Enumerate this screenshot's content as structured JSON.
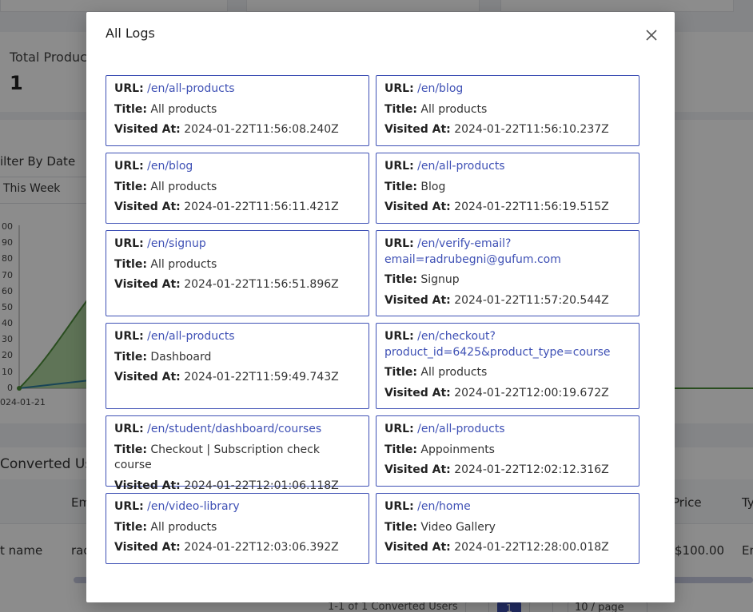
{
  "background": {
    "total_label": "Total Produc",
    "total_value": "1",
    "filter_label": "ilter By Date",
    "filter_value": "This Week",
    "chart_ticks": [
      "00",
      "90",
      "80",
      "70",
      "60",
      "50",
      "40",
      "30",
      "20",
      "10",
      "0"
    ],
    "chart_xlabel": "024-01-21",
    "table_title": "Converted Us",
    "table_headers": {
      "email": "Em",
      "price": "Price",
      "type": "Ty"
    },
    "table_row": {
      "name": "t name",
      "email": "rad",
      "price": "$100.00",
      "type": "En"
    },
    "pager_text": "1-1 of 1 Converted Users",
    "pager_current": "1",
    "page_size": "10 / page"
  },
  "modal": {
    "title": "All Logs",
    "labels": {
      "url": "URL:",
      "title": "Title:",
      "visited": "Visited At:"
    },
    "logs": [
      {
        "url": "/en/all-products",
        "title": "All products",
        "visited_at": "2024-01-22T11:56:08.240Z"
      },
      {
        "url": "/en/blog",
        "title": "All products",
        "visited_at": "2024-01-22T11:56:10.237Z"
      },
      {
        "url": "/en/blog",
        "title": "All products",
        "visited_at": "2024-01-22T11:56:11.421Z"
      },
      {
        "url": "/en/all-products",
        "title": "Blog",
        "visited_at": "2024-01-22T11:56:19.515Z"
      },
      {
        "url": "/en/signup",
        "title": "All products",
        "visited_at": "2024-01-22T11:56:51.896Z"
      },
      {
        "url": "/en/verify-email?email=radrubegni@gufum.com",
        "title": "Signup",
        "visited_at": "2024-01-22T11:57:20.544Z"
      },
      {
        "url": "/en/all-products",
        "title": "Dashboard",
        "visited_at": "2024-01-22T11:59:49.743Z"
      },
      {
        "url": "/en/checkout?product_id=6425&product_type=course",
        "title": "All products",
        "visited_at": "2024-01-22T12:00:19.672Z"
      },
      {
        "url": "/en/student/dashboard/courses",
        "title": "Checkout | Subscription check course",
        "visited_at": "2024-01-22T12:01:06.118Z"
      },
      {
        "url": "/en/all-products",
        "title": "Appoinments",
        "visited_at": "2024-01-22T12:02:12.316Z"
      },
      {
        "url": "/en/video-library",
        "title": "All products",
        "visited_at": "2024-01-22T12:03:06.392Z"
      },
      {
        "url": "/en/home",
        "title": "Video Gallery",
        "visited_at": "2024-01-22T12:28:00.018Z"
      }
    ]
  },
  "colors": {
    "accent": "#3f51b5",
    "chart_green": "#4c8c3a"
  },
  "icons": {
    "close": "close-icon"
  }
}
